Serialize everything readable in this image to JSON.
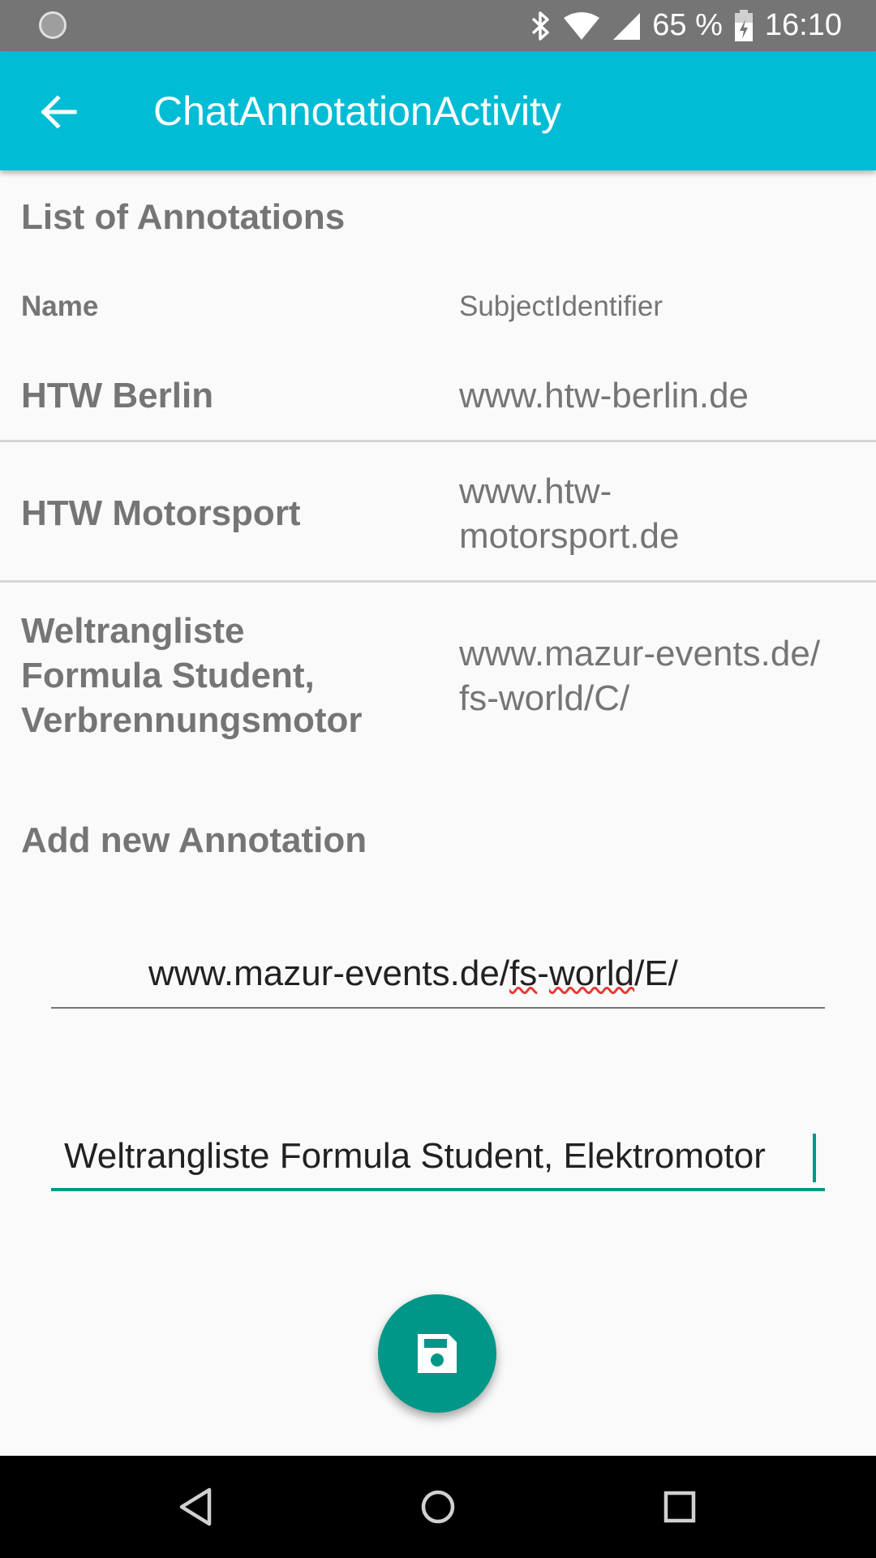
{
  "status_bar": {
    "battery": "65 %",
    "time": "16:10",
    "icons": [
      "loading-icon",
      "bluetooth-icon",
      "wifi-icon",
      "signal-icon",
      "battery-icon"
    ]
  },
  "app_bar": {
    "title": "ChatAnnotationActivity",
    "color": "#00bcd4"
  },
  "list": {
    "section_title": "List of Annotations",
    "col_name": "Name",
    "col_subject": "SubjectIdentifier",
    "rows": [
      {
        "name": "HTW Berlin",
        "subject": "www.htw-berlin.de"
      },
      {
        "name": "HTW Motorsport",
        "subject_line1": "www.htw-",
        "subject_line2": "motorsport.de"
      },
      {
        "name_line1": "Weltrangliste",
        "name_line2": "Formula Student,",
        "name_line3": "Verbrennungsmotor",
        "subject_line1": "www.mazur-events.de/",
        "subject_line2": "fs-world/C/"
      }
    ]
  },
  "add": {
    "section_title": "Add new Annotation",
    "subject_input": {
      "value_part1": "www.mazur-events.de/",
      "value_part2": "fs",
      "value_part3": "-",
      "value_part4": "world",
      "value_part5": "/E/"
    },
    "name_input": {
      "value": "Weltrangliste Formula Student, Elektromotor"
    },
    "save_icon": "save-icon",
    "accent": "#009688"
  },
  "nav_bar": {
    "icons": [
      "back-triangle-icon",
      "home-circle-icon",
      "recents-square-icon"
    ]
  }
}
